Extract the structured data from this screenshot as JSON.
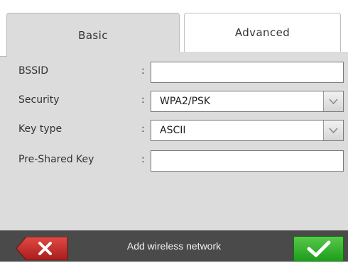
{
  "tabs": {
    "basic_label": "Basic",
    "advanced_label": "Advanced",
    "active": "Basic"
  },
  "form": {
    "bssid": {
      "label": "BSSID",
      "separator": ":",
      "value": ""
    },
    "security": {
      "label": "Security",
      "separator": ":",
      "value": "WPA2/PSK"
    },
    "key_type": {
      "label": "Key type",
      "separator": ":",
      "value": "ASCII"
    },
    "pre_shared_key": {
      "label": "Pre-Shared Key",
      "separator": ":",
      "value": ""
    }
  },
  "footer": {
    "title": "Add wireless network",
    "cancel_icon": "close-x-icon",
    "confirm_icon": "checkmark-icon"
  },
  "colors": {
    "panel_bg": "#dcdcdc",
    "footer_bg": "#4a4a4a",
    "cancel_red": "#c62828",
    "confirm_green": "#2fb02a"
  }
}
